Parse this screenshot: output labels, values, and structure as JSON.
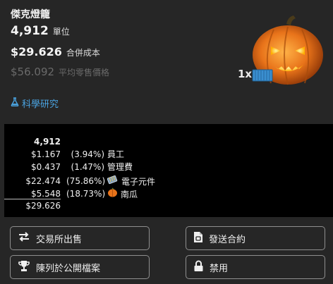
{
  "product": {
    "name": "傑克燈籠",
    "units_value": "4,912",
    "units_label": "單位",
    "cost_value": "$29.626",
    "cost_label": "合併成本",
    "retail_value": "$56.092",
    "retail_label": "平均零售價格"
  },
  "science_link": "科學研究",
  "art": {
    "quantity_badge": "1x"
  },
  "breakdown": {
    "total_units": "4,912",
    "rows": [
      {
        "amount": "$1.167",
        "percent": "(3.94%)",
        "name": "員工"
      },
      {
        "amount": "$0.437",
        "percent": "(1.47%)",
        "name": "管理費"
      },
      {
        "amount": "$22.474",
        "percent": "(75.86%)",
        "name": "電子元件"
      },
      {
        "amount": "$5.548",
        "percent": "(18.73%)",
        "name": "南瓜"
      }
    ],
    "total": "$29.626"
  },
  "buttons": {
    "sell_exchange": "交易所出售",
    "send_contract": "發送合約",
    "list_public": "陳列於公開檔案",
    "disabled": "禁用"
  },
  "colors": {
    "background": "#262626",
    "panel": "#000000",
    "link": "#4aa3e0",
    "muted": "#6a6a6a"
  }
}
